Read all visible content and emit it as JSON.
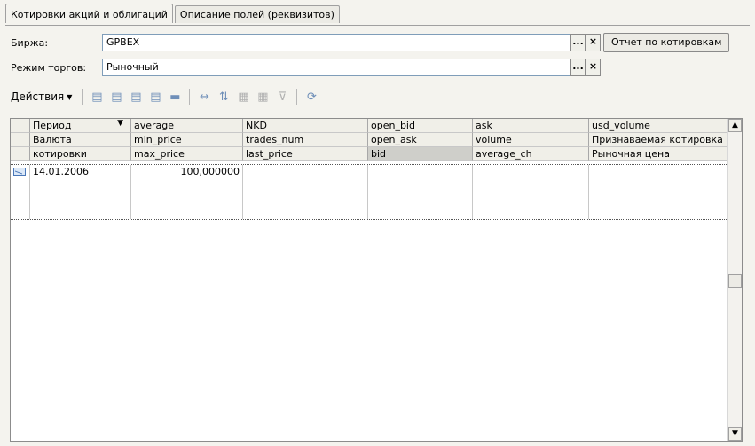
{
  "tabs": [
    "Котировки акций и облигаций",
    "Описание полей (реквизитов)"
  ],
  "form": {
    "exchange_label": "Биржа:",
    "exchange_value": "GPBEX",
    "mode_label": "Режим торгов:",
    "mode_value": "Рыночный",
    "select_btn": "...",
    "clear_btn": "×",
    "report_btn": "Отчет по котировкам"
  },
  "toolbar": {
    "actions_label": "Действия"
  },
  "grid": {
    "header_row1": [
      "Период",
      "average",
      "NKD",
      "open_bid",
      "ask",
      "usd_volume"
    ],
    "header_row2": [
      "Валюта",
      "min_price",
      "trades_num",
      "open_ask",
      "volume",
      "Признаваемая котировка"
    ],
    "header_row3": [
      "котировки",
      "max_price",
      "last_price",
      "bid",
      "average_ch",
      "Рыночная цена"
    ],
    "rows": [
      {
        "period": "14.01.2006",
        "average": "100,000000"
      }
    ]
  }
}
